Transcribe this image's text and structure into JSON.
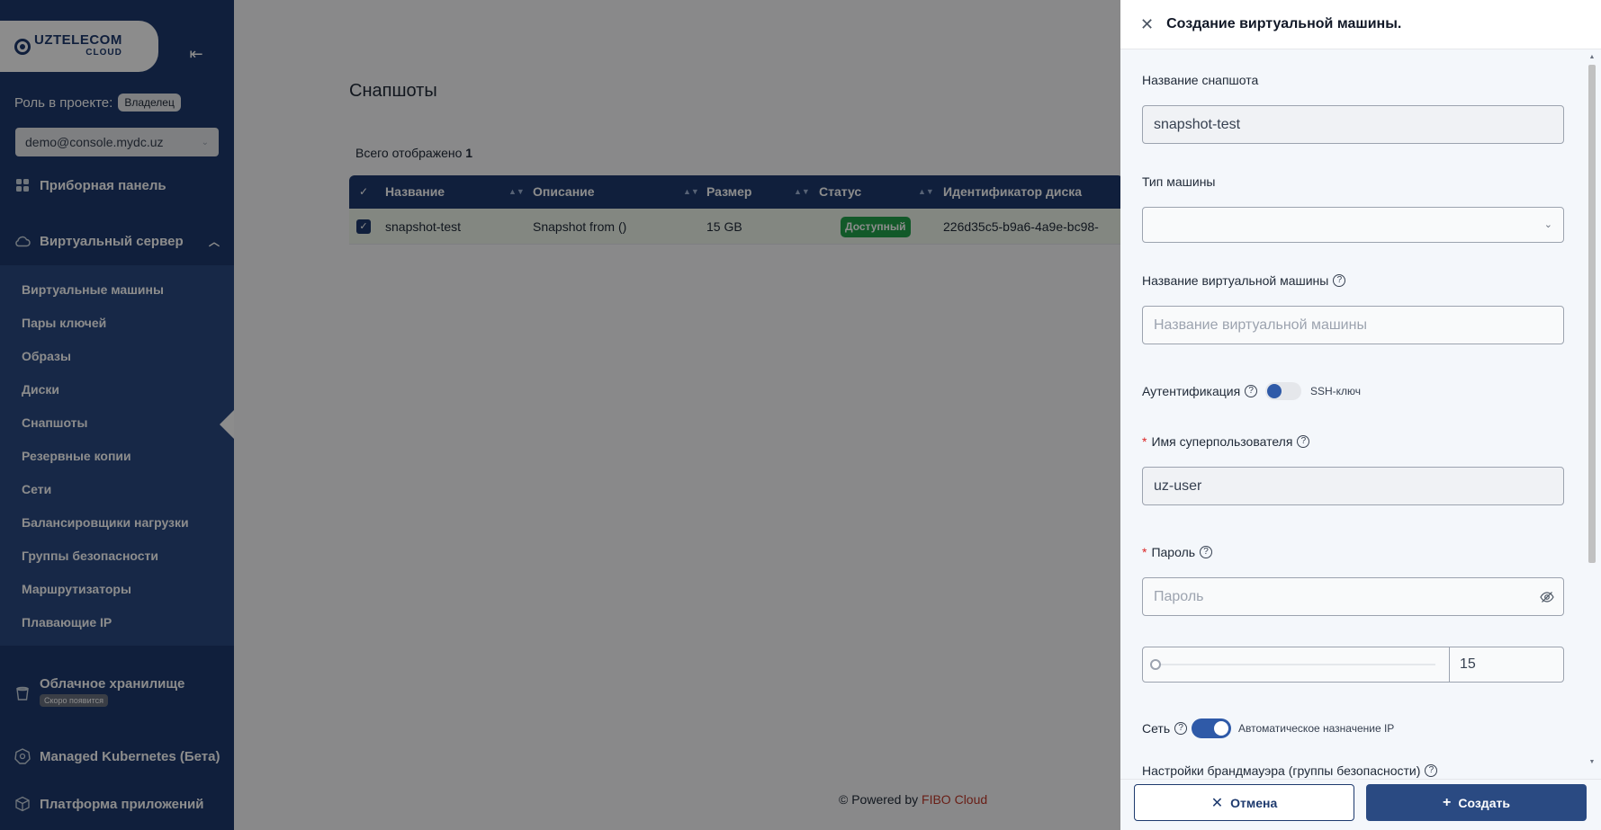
{
  "brand": {
    "name": "UZTELECOM",
    "sub": "CLOUD"
  },
  "sidebar": {
    "role_label": "Роль в проекте:",
    "role_value": "Владелец",
    "project": "demo@console.mydc.uz",
    "dashboard": "Приборная панель",
    "virtual_server": "Виртуальный сервер",
    "items": [
      "Виртуальные машины",
      "Пары ключей",
      "Образы",
      "Диски",
      "Снапшоты",
      "Резервные копии",
      "Сети",
      "Балансировщики нагрузки",
      "Группы безопасности",
      "Маршрутизаторы",
      "Плавающие IP"
    ],
    "storage": "Облачное хранилище",
    "storage_badge": "Скоро появится",
    "kubernetes": "Managed Kubernetes (Бета)",
    "platform": "Платформа приложений"
  },
  "main": {
    "title": "Снапшоты",
    "count_label": "Всего отображено",
    "count_value": "1",
    "columns": [
      "Название",
      "Описание",
      "Размер",
      "Статус",
      "Идентификатор диска"
    ],
    "row": {
      "name": "snapshot-test",
      "description": "Snapshot from ()",
      "size": "15 GB",
      "status": "Доступный",
      "disk_id": "226d35c5-b9a6-4a9e-bc98-"
    },
    "footer_prefix": "© Powered by",
    "footer_brand": "FIBO Cloud"
  },
  "drawer": {
    "title": "Создание виртуальной машины.",
    "snapshot_label": "Название снапшота",
    "snapshot_value": "snapshot-test",
    "machine_type_label": "Тип машины",
    "machine_type_value": "",
    "vm_name_label": "Название виртуальной машины",
    "vm_name_placeholder": "Название виртуальной машины",
    "auth_label": "Аутентификация",
    "auth_option": "SSH-ключ",
    "superuser_label": "Имя суперпользователя",
    "superuser_value": "uz-user",
    "password_label": "Пароль",
    "password_placeholder": "Пароль",
    "disk_size_value": "15",
    "network_label": "Сеть",
    "network_option": "Автоматическое назначение IP",
    "firewall_label": "Настройки брандмауэра (группы безопасности)",
    "cancel": "Отмена",
    "create": "Создать"
  },
  "colors": {
    "primary": "#1e3a6e",
    "success": "#22a34b",
    "brand_red": "#c0392b"
  }
}
